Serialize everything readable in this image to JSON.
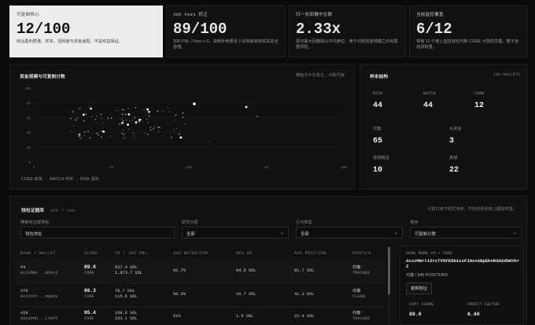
{
  "kpis": [
    {
      "label": "可复制核心",
      "value": "12/100",
      "desc": "综合盈利质量、样本、活跃度与资金适配，不是收益保证。"
    },
    {
      "label": "30D Fees 转正",
      "value": "89/100",
      "desc": "30D PNL / Fees > 0，说明手续费至少没有被库存损失完全吞噬。"
    },
    {
      "label": "归一化回撤中位数",
      "value": "2.33x",
      "desc": "逐日最大回撤除以平均单位，用于识别资金规模之外的尾部风险。"
    },
    {
      "label": "当前监控覆盖",
      "value": "6/12",
      "desc": "现有 12 个链上监控钱包与新 CORE 分层的交集，暂不自动改权重。"
    }
  ],
  "scatter": {
    "title": "资金规模与可复制分数",
    "note": "横轴为平均单位，对数尺度",
    "y_ticks": [
      "100",
      "80",
      "60",
      "40",
      "20",
      "0"
    ],
    "x_ticks": [
      "1",
      "10",
      "100",
      "1K",
      "10K"
    ],
    "legend": [
      {
        "label": "CORE 高亮",
        "color": "#ffffff"
      },
      {
        "label": "WATCH 中灰",
        "color": "#8e8e8e"
      },
      {
        "label": "RISK 深灰",
        "color": "#4a4a4a"
      }
    ]
  },
  "sample": {
    "title": "样本结构",
    "count": "100 WALLETS",
    "cells": [
      {
        "k": "RISK",
        "v": "44"
      },
      {
        "k": "WATCH",
        "v": "44"
      },
      {
        "k": "CORE",
        "v": "12"
      },
      {
        "k": "均衡",
        "v": "65"
      },
      {
        "k": "大资金",
        "v": "3"
      },
      {
        "k": "低频精选",
        "v": "10"
      },
      {
        "k": "高频",
        "v": "22"
      }
    ]
  },
  "wallets": {
    "title": "钱包证据库",
    "count": "100 / 100",
    "note": "分数只用于研究排序，不自动修改链上跟踪权重。",
    "filters": {
      "search_label": "搜索地址或排名",
      "search_placeholder": "钱包地址",
      "tier_label": "研究分层",
      "tier_value": "全部",
      "behavior_label": "行为类型",
      "behavior_value": "全部",
      "sort_label": "排序",
      "sort_value": "可复制分数"
    },
    "columns": [
      "RANK / WALLET",
      "SCORE",
      "7D / 30D PNL",
      "30D RETENTION",
      "MAX DD",
      "AVG POSITION",
      "PROFILE"
    ],
    "rows": [
      {
        "rank": "#4",
        "wallet": "AczcMWr...WXkrZ",
        "score": "89.0",
        "tier": "CORE",
        "pnl7": "937.4 SOL",
        "pnl30": "1,973.7 SOL",
        "retention": "92.7%",
        "dd": "64.5 SOL",
        "avg": "81.7 SOL",
        "profile": "均衡",
        "state": "TRACKED"
      },
      {
        "rank": "#76",
        "wallet": "GointPc...mqB8v",
        "score": "86.3",
        "tier": "CORE",
        "pnl7": "78.7 SOL",
        "pnl30": "115.6 SOL",
        "retention": "56.3%",
        "dd": "10.7 SOL",
        "avg": "41.3 SOL",
        "profile": "均衡",
        "state": "CLEAN"
      },
      {
        "rank": "#28",
        "wallet": "G8oabMU...L43Pt",
        "score": "85.4",
        "tier": "CORE",
        "pnl7": "168.6 SOL",
        "pnl30": "233.1 SOL",
        "retention": "51%",
        "dd": "1.9 SOL",
        "avg": "22.4 SOL",
        "profile": "均衡",
        "state": "TRACKED"
      }
    ]
  },
  "detail": {
    "title": "DUNE RANK #4 / CORE",
    "address": "AczcMWrti2rcTV6FK5G1zsFJWzxANpEkoR3H2dGWVkrZ",
    "meta": "均衡 / 845 POSITIONS",
    "copy_btn": "复制地址",
    "copy_score_label": "COPY SCORE",
    "copy_score": "89.0",
    "profit_factor_label": "PROFIT FACTOR",
    "profit_factor": "6.40"
  },
  "colors": {
    "accent": "#ececec",
    "bg": "#0b0b0b",
    "panel": "#111111"
  }
}
